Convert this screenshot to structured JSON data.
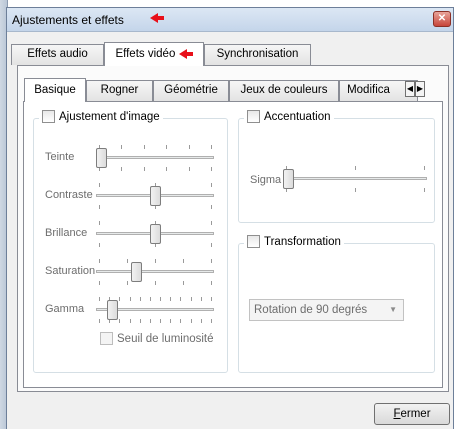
{
  "window": {
    "title": "Ajustements et effets",
    "close_icon": "close-icon"
  },
  "outer_tabs": [
    {
      "label": "Effets audio"
    },
    {
      "label": "Effets vidéo"
    },
    {
      "label": "Synchronisation"
    }
  ],
  "inner_tabs": [
    {
      "label": "Basique"
    },
    {
      "label": "Rogner"
    },
    {
      "label": "Géométrie"
    },
    {
      "label": "Jeux de couleurs"
    },
    {
      "label": "Modifica"
    }
  ],
  "image_adjust": {
    "title": "Ajustement d'image",
    "checked": false,
    "sliders": [
      {
        "label": "Teinte",
        "level": 0.0
      },
      {
        "label": "Contraste",
        "level": 0.5
      },
      {
        "label": "Brillance",
        "level": 0.5
      },
      {
        "label": "Saturation",
        "level": 0.33
      },
      {
        "label": "Gamma",
        "level": 0.1
      }
    ],
    "threshold_label": "Seuil de luminosité"
  },
  "sharpen": {
    "title": "Accentuation",
    "checked": false,
    "slider_label": "Sigma",
    "level": 0.0
  },
  "transform": {
    "title": "Transformation",
    "checked": false,
    "select_value": "Rotation de 90 degrés"
  },
  "buttons": {
    "close_label": "Fermer",
    "close_mnemonic": "F"
  },
  "colors": {
    "annotation_arrow": "#e8101a",
    "title_bar": "#c4d5ea"
  }
}
